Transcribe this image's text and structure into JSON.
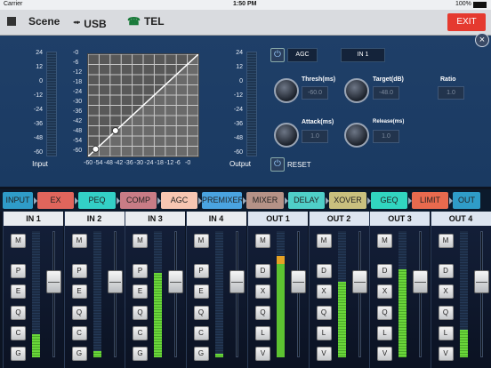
{
  "status_bar": {
    "carrier": "Carrier",
    "time": "1:50 PM",
    "battery": "100%"
  },
  "toolbar": {
    "scene_label": "Scene",
    "usb_label": "USB",
    "tel_label": "TEL",
    "exit_label": "EXIT",
    "grid_icon": "grid-icon",
    "usb_icon": "usb-icon",
    "phone_icon": "phone-icon"
  },
  "input_meter": {
    "ticks": [
      "24",
      "12",
      "0",
      "-12",
      "-24",
      "-36",
      "-48",
      "-60"
    ],
    "label": "Input"
  },
  "output_meter": {
    "ticks": [
      "24",
      "12",
      "0",
      "-12",
      "-24",
      "-36",
      "-48",
      "-60"
    ],
    "label": "Output"
  },
  "graph": {
    "y_ticks": [
      "-0",
      "-6",
      "-12",
      "-18",
      "-24",
      "-30",
      "-36",
      "-42",
      "-48",
      "-54",
      "-60"
    ],
    "x_ticks": [
      "-60",
      "-54",
      "-48",
      "-42",
      "-36",
      "-30",
      "-24",
      "-18",
      "-12",
      "-6",
      "-0"
    ]
  },
  "agc": {
    "title": "AGC",
    "channel": "IN 1",
    "reset_label": "RESET",
    "thresh_label": "Thresh(ms)",
    "thresh_value": "-60.0",
    "target_label": "Target(dB)",
    "target_value": "-48.0",
    "ratio_label": "Ratio",
    "ratio_value": "1.0",
    "attack_label": "Attack(ms)",
    "attack_value": "1.0",
    "release_label": "Release(ms)",
    "release_value": "1.0"
  },
  "tabs": [
    {
      "label": "INPUT",
      "color": "#2f9cc8"
    },
    {
      "label": "EX",
      "color": "#e0655c"
    },
    {
      "label": "PEQ",
      "color": "#33d0c6"
    },
    {
      "label": "COMP",
      "color": "#c87c86"
    },
    {
      "label": "AGC",
      "color": "#f7c6b2"
    },
    {
      "label": "PREMIXER",
      "color": "#4aa3e0"
    },
    {
      "label": "MIXER",
      "color": "#b59287"
    },
    {
      "label": "DELAY",
      "color": "#4fcfc8"
    },
    {
      "label": "XOVER",
      "color": "#c9c07e"
    },
    {
      "label": "GEQ",
      "color": "#31d5c0"
    },
    {
      "label": "LIMIT",
      "color": "#e86a4e"
    },
    {
      "label": "OUT",
      "color": "#2f9cc8"
    }
  ],
  "inputs": [
    {
      "name": "IN 1",
      "buttons": [
        "M",
        "P",
        "E",
        "Q",
        "C",
        "G"
      ],
      "level": 0.18,
      "fader": 0.62
    },
    {
      "name": "IN 2",
      "buttons": [
        "M",
        "P",
        "E",
        "Q",
        "C",
        "G"
      ],
      "level": 0.05,
      "fader": 0.62
    },
    {
      "name": "IN 3",
      "buttons": [
        "M",
        "P",
        "E",
        "Q",
        "C",
        "G"
      ],
      "level": 0.67,
      "fader": 0.62
    },
    {
      "name": "IN 4",
      "buttons": [
        "M",
        "P",
        "E",
        "Q",
        "C",
        "G"
      ],
      "level": 0.03,
      "fader": 0.62
    }
  ],
  "outputs": [
    {
      "name": "OUT 1",
      "buttons": [
        "M",
        "D",
        "X",
        "Q",
        "L",
        "V"
      ],
      "level": 0.8,
      "fader": 0.62
    },
    {
      "name": "OUT 2",
      "buttons": [
        "M",
        "D",
        "X",
        "Q",
        "L",
        "V"
      ],
      "level": 0.6,
      "fader": 0.62
    },
    {
      "name": "OUT 3",
      "buttons": [
        "M",
        "D",
        "X",
        "Q",
        "L",
        "V"
      ],
      "level": 0.7,
      "fader": 0.62
    },
    {
      "name": "OUT 4",
      "buttons": [
        "M",
        "D",
        "X",
        "Q",
        "L",
        "V"
      ],
      "level": 0.22,
      "fader": 0.62
    }
  ]
}
